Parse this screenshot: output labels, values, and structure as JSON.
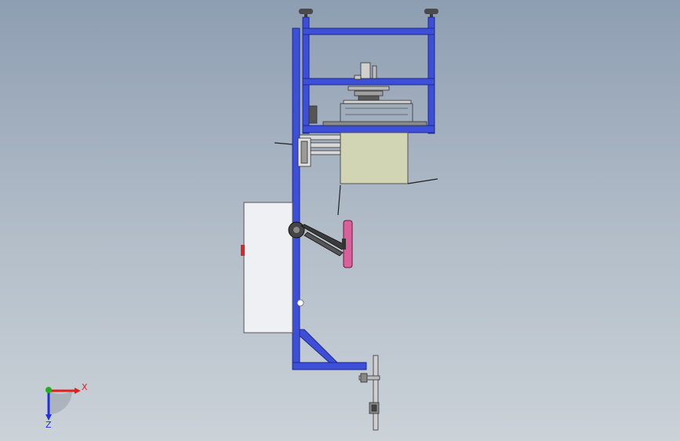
{
  "view": {
    "background_top": "#8e9eb2",
    "background_bottom": "#cbd2d8"
  },
  "colors": {
    "frame": "#3d4fd6",
    "frame_edge": "#1d2a8e",
    "cabinet": "#eef0f3",
    "hopper": "#d1d5b4",
    "roller": "#d9609a",
    "axis_x": "#e02020",
    "axis_y": "#20b020",
    "axis_z": "#2030e0"
  },
  "triad": {
    "x_label": "X",
    "z_label": "Z"
  }
}
